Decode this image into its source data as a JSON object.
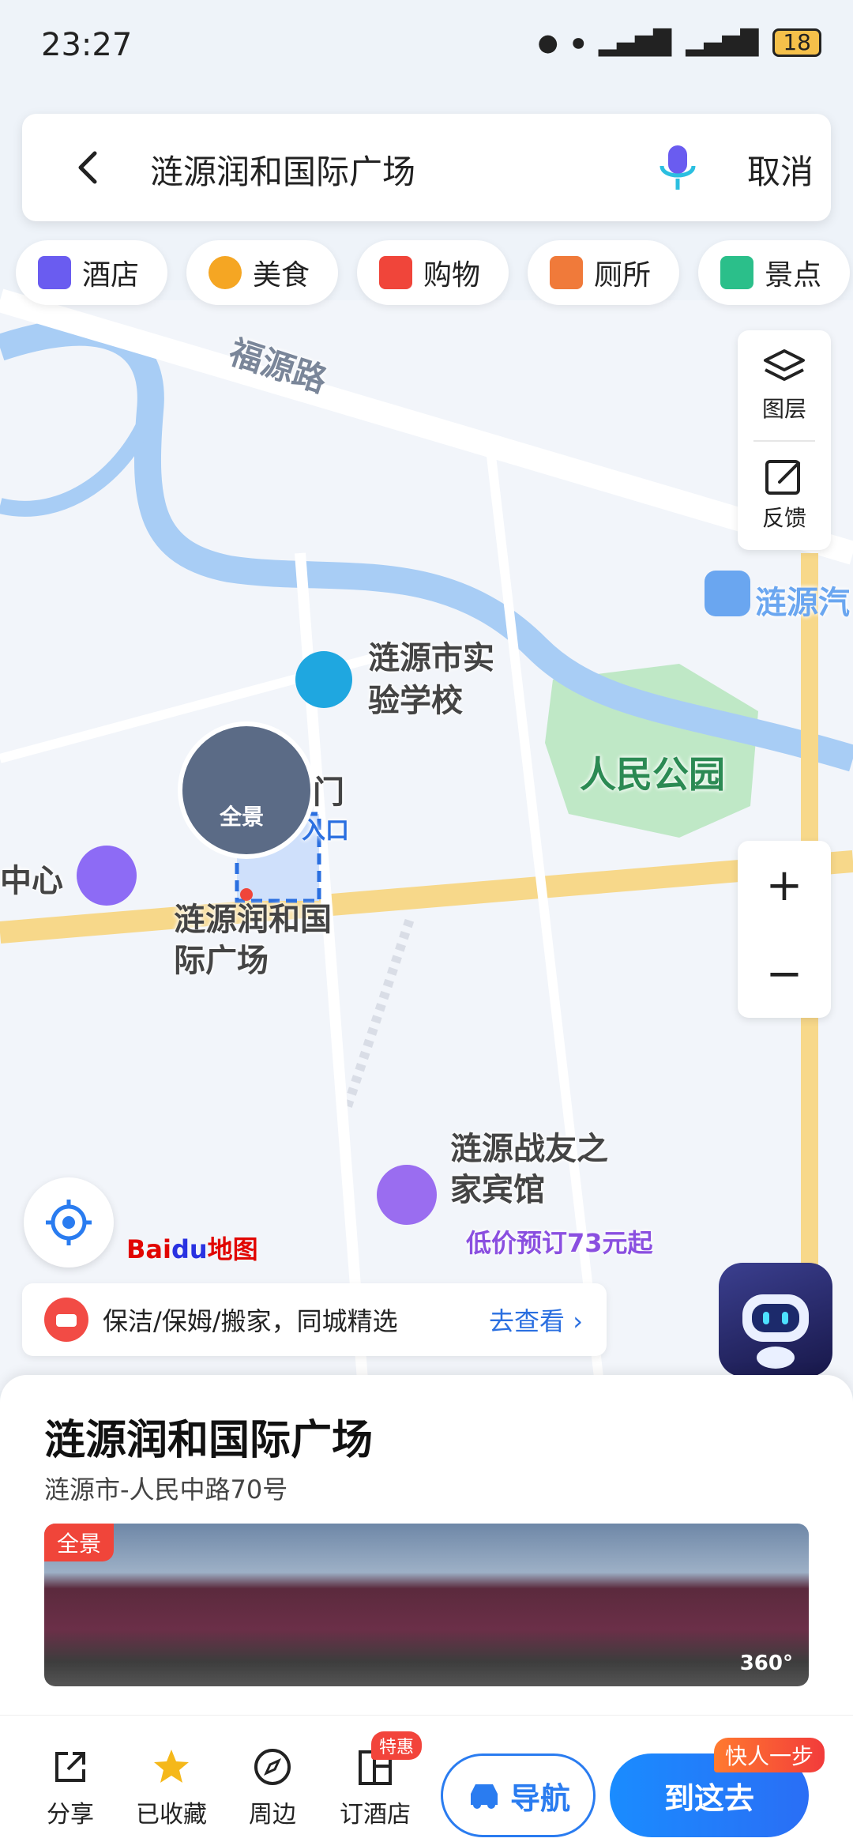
{
  "status_bar": {
    "time": "23:27",
    "battery": "18"
  },
  "search": {
    "query": "涟源润和国际广场",
    "cancel_label": "取消"
  },
  "categories": [
    {
      "label": "酒店",
      "color": "#6a5cf0"
    },
    {
      "label": "美食",
      "color": "#f5a623"
    },
    {
      "label": "购物",
      "color": "#f0453a"
    },
    {
      "label": "厕所",
      "color": "#f07a3a"
    },
    {
      "label": "景点",
      "color": "#2bbf8a"
    }
  ],
  "side_panel": {
    "layers_label": "图层",
    "feedback_label": "反馈"
  },
  "zoom": {
    "in_label": "+",
    "out_label": "−"
  },
  "map_labels": {
    "road_fuyuan": "福源路",
    "school": "涟源市实验学校",
    "park": "人民公园",
    "bus_station": "涟源汽",
    "center_partial": "中心",
    "gate_partial": "门",
    "entrance_partial": "入口",
    "panorama_pin": "全景",
    "selected_place": "涟源润和国际广场",
    "hotel": "涟源战友之家宾馆",
    "hotel_price": "低价预订73元起"
  },
  "baidu_logo": {
    "bai": "Bai",
    "du": "du",
    "ditu": "地图"
  },
  "promo": {
    "text": "保洁/保姆/搬家，同城精选",
    "link": "去查看"
  },
  "place": {
    "title": "涟源润和国际广场",
    "address": "涟源市-人民中路70号",
    "photo_tag": "全景",
    "photo_360": "360°"
  },
  "actions": {
    "share": "分享",
    "saved": "已收藏",
    "nearby": "周边",
    "book_hotel": "订酒店",
    "book_hotel_badge": "特惠",
    "navigate": "导航",
    "go_here": "到这去",
    "go_badge": "快人一步"
  }
}
